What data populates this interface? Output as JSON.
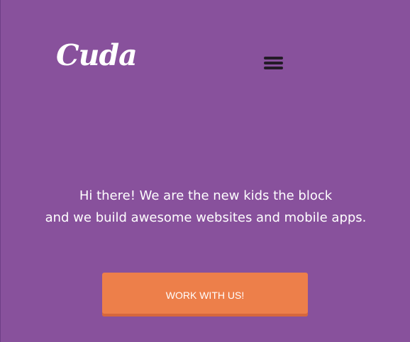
{
  "brand": {
    "logo_text": "Cuda"
  },
  "nav": {
    "menu_icon": "hamburger-menu-icon"
  },
  "hero": {
    "line1": "Hi there! We are the new kids the block",
    "line2": "and we build awesome websites and mobile apps.",
    "cta_label": "WORK WITH US!"
  },
  "colors": {
    "background": "#88519c",
    "accent": "#ed7f4a",
    "menu_icon": "#231b27",
    "text": "#ffffff"
  }
}
